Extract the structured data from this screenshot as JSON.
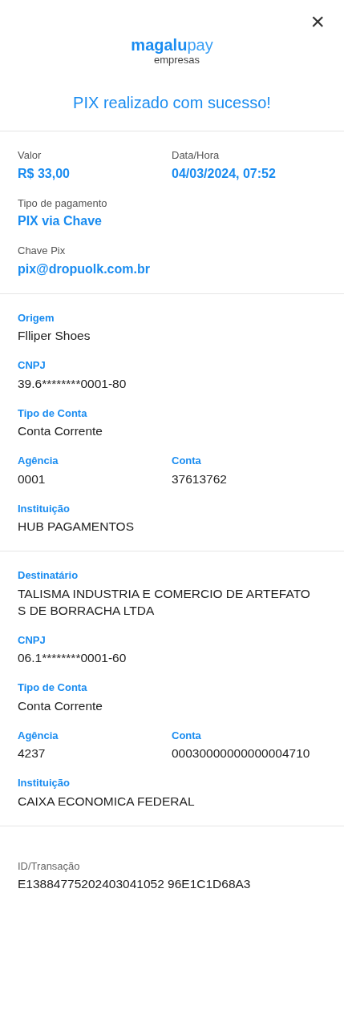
{
  "close_button": "×",
  "logo": {
    "brand": "magalu",
    "product": "pay",
    "tagline": "empresas"
  },
  "title": "PIX realizado com sucesso!",
  "sections": [
    {
      "kind": "summary",
      "rows": [
        [
          {
            "label": "Valor",
            "value": "R$ 33,00"
          },
          {
            "label": "Data/Hora",
            "value": "04/03/2024, 07:52"
          }
        ],
        [
          {
            "label": "Tipo de pagamento",
            "value": "PIX via Chave"
          }
        ],
        [
          {
            "label": "Chave Pix",
            "value": "pix@dropuolk.com.br"
          }
        ]
      ]
    },
    {
      "kind": "party",
      "rows": [
        [
          {
            "label": "Origem",
            "value": "Flliper Shoes"
          }
        ],
        [
          {
            "label": "CNPJ",
            "value": "39.6********0001-80"
          }
        ],
        [
          {
            "label": "Tipo de Conta",
            "value": "Conta Corrente"
          }
        ],
        [
          {
            "label": "Agência",
            "value": "0001"
          },
          {
            "label": "Conta",
            "value": "37613762"
          }
        ],
        [
          {
            "label": "Instituição",
            "value": "HUB PAGAMENTOS"
          }
        ]
      ]
    },
    {
      "kind": "party",
      "rows": [
        [
          {
            "label": "Destinatário",
            "value": "TALISMA INDUSTRIA E COMERCIO DE ARTEFATOS DE BORRACHA LTDA"
          }
        ],
        [
          {
            "label": "CNPJ",
            "value": "06.1********0001-60"
          }
        ],
        [
          {
            "label": "Tipo de Conta",
            "value": "Conta Corrente"
          }
        ],
        [
          {
            "label": "Agência",
            "value": "4237"
          },
          {
            "label": "Conta",
            "value": "00030000000000004710"
          }
        ],
        [
          {
            "label": "Instituição",
            "value": "CAIXA ECONOMICA FEDERAL"
          }
        ]
      ]
    },
    {
      "kind": "plain",
      "rows": [
        [
          {
            "label": "ID/Transação",
            "value": "E13884775202403041052 96E1C1D68A3"
          }
        ]
      ]
    }
  ]
}
